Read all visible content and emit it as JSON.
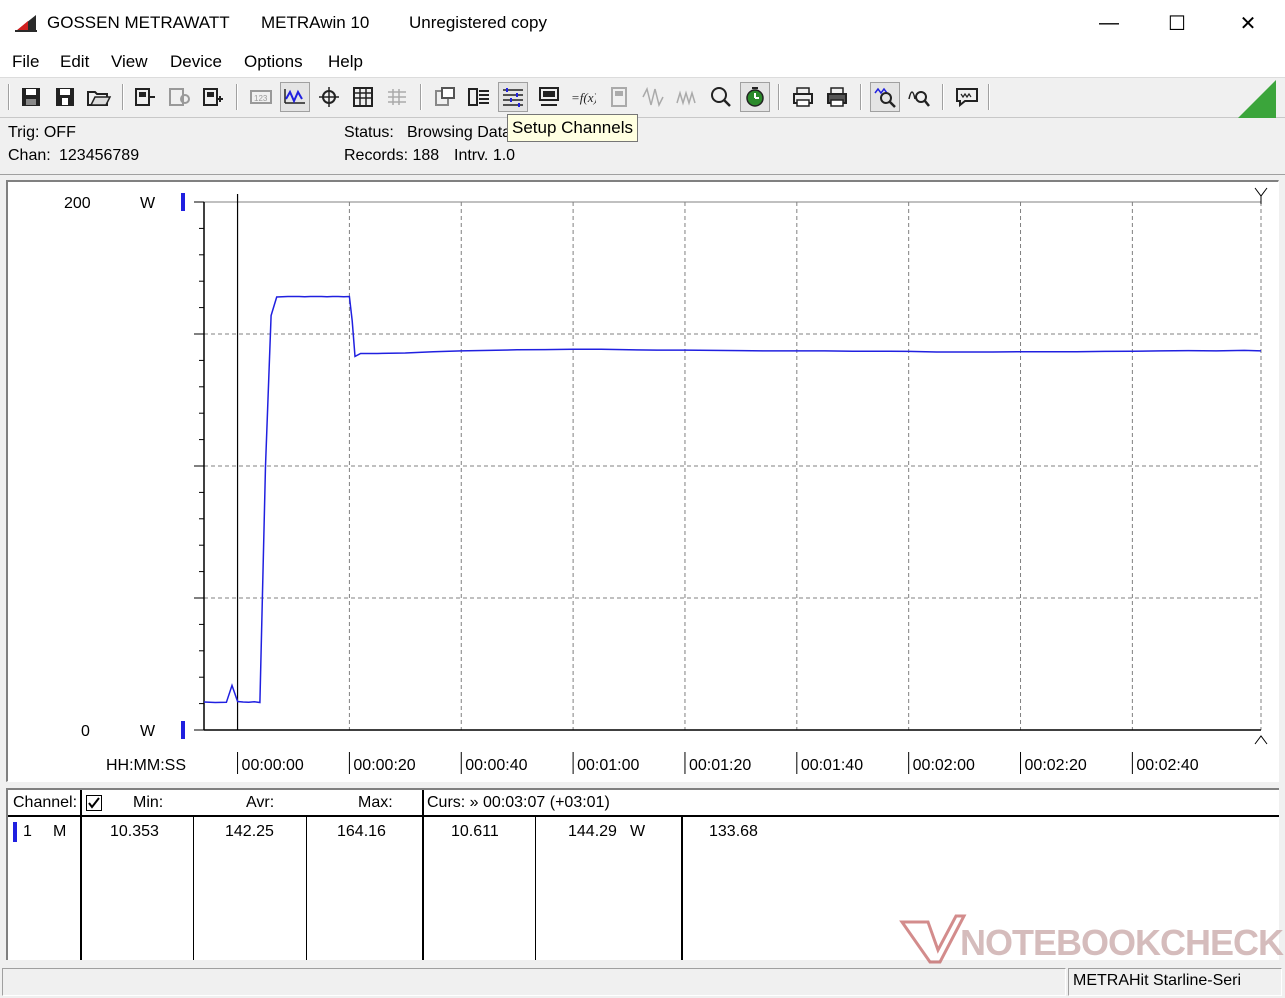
{
  "title": {
    "vendor": "GOSSEN METRAWATT",
    "app": "METRAwin 10",
    "registration": "Unregistered copy",
    "minimize": "—",
    "maximize": "☐",
    "close": "✕"
  },
  "menu": {
    "file": "File",
    "edit": "Edit",
    "view": "View",
    "device": "Device",
    "options": "Options",
    "help": "Help"
  },
  "status": {
    "trig": "Trig: OFF",
    "chan_label": "Chan:",
    "chan_value": "123456789",
    "status_label": "Status:",
    "status_value": "Browsing Data",
    "records_label": "Records: 188",
    "interval_label": "Intrv. 1.0"
  },
  "tooltip": "Setup Channels",
  "chart_data": {
    "type": "line",
    "x_axis_label": "HH:MM:SS",
    "x_ticks": [
      "00:00:00",
      "00:00:20",
      "00:00:40",
      "00:01:00",
      "00:01:20",
      "00:01:40",
      "00:02:00",
      "00:02:20",
      "00:02:40"
    ],
    "x_range_seconds": [
      -6,
      183
    ],
    "y_top_label": "200",
    "y_bottom_label": "0",
    "y_unit": "W",
    "ylim": [
      0,
      200
    ],
    "grid": true,
    "line_color": "#2020e0",
    "cursor_x_seconds": 0,
    "series": [
      {
        "x": [
          -6,
          -4,
          -2,
          -1,
          0,
          1,
          2,
          3,
          4,
          5,
          6,
          7,
          8,
          9,
          10,
          11,
          12,
          13,
          14,
          15,
          16,
          17,
          18,
          19,
          20,
          20.5,
          21,
          22,
          25,
          30,
          35,
          40,
          45,
          50,
          55,
          60,
          65,
          70,
          75,
          80,
          85,
          90,
          95,
          100,
          105,
          110,
          115,
          120,
          125,
          130,
          135,
          140,
          145,
          150,
          155,
          160,
          165,
          170,
          175,
          180,
          183
        ],
        "values": [
          10.6,
          10.4,
          10.5,
          16.9,
          10.8,
          10.6,
          10.5,
          10.7,
          10.4,
          100.0,
          157.0,
          164.0,
          164.1,
          164.2,
          164.2,
          164.2,
          164.1,
          164.2,
          164.2,
          164.2,
          164.1,
          164.2,
          164.2,
          164.1,
          164.2,
          155.0,
          141.5,
          142.6,
          142.6,
          142.8,
          143.3,
          143.6,
          143.8,
          144.0,
          144.1,
          144.2,
          144.2,
          144.0,
          143.9,
          143.9,
          143.8,
          143.7,
          143.6,
          143.6,
          143.6,
          143.5,
          143.5,
          143.4,
          143.2,
          143.2,
          143.2,
          143.3,
          143.3,
          143.3,
          143.4,
          143.5,
          143.6,
          143.7,
          143.6,
          143.8,
          143.6
        ]
      }
    ]
  },
  "table": {
    "headers": {
      "channel": "Channel:",
      "min": "Min:",
      "avr": "Avr:",
      "max": "Max:",
      "cursor": "Curs: » 00:03:07 (+03:01)"
    },
    "row": {
      "channel_no": "1",
      "mode": "M",
      "min": "10.353",
      "avr": "142.25",
      "max": "164.16",
      "curs_a": "10.611",
      "curs_b": "144.29",
      "unit": "W",
      "curs_c": "133.68"
    }
  },
  "statusbar": {
    "device": "METRAHit Starline-Seri"
  },
  "watermark": "NOTEBOOKCHECK"
}
